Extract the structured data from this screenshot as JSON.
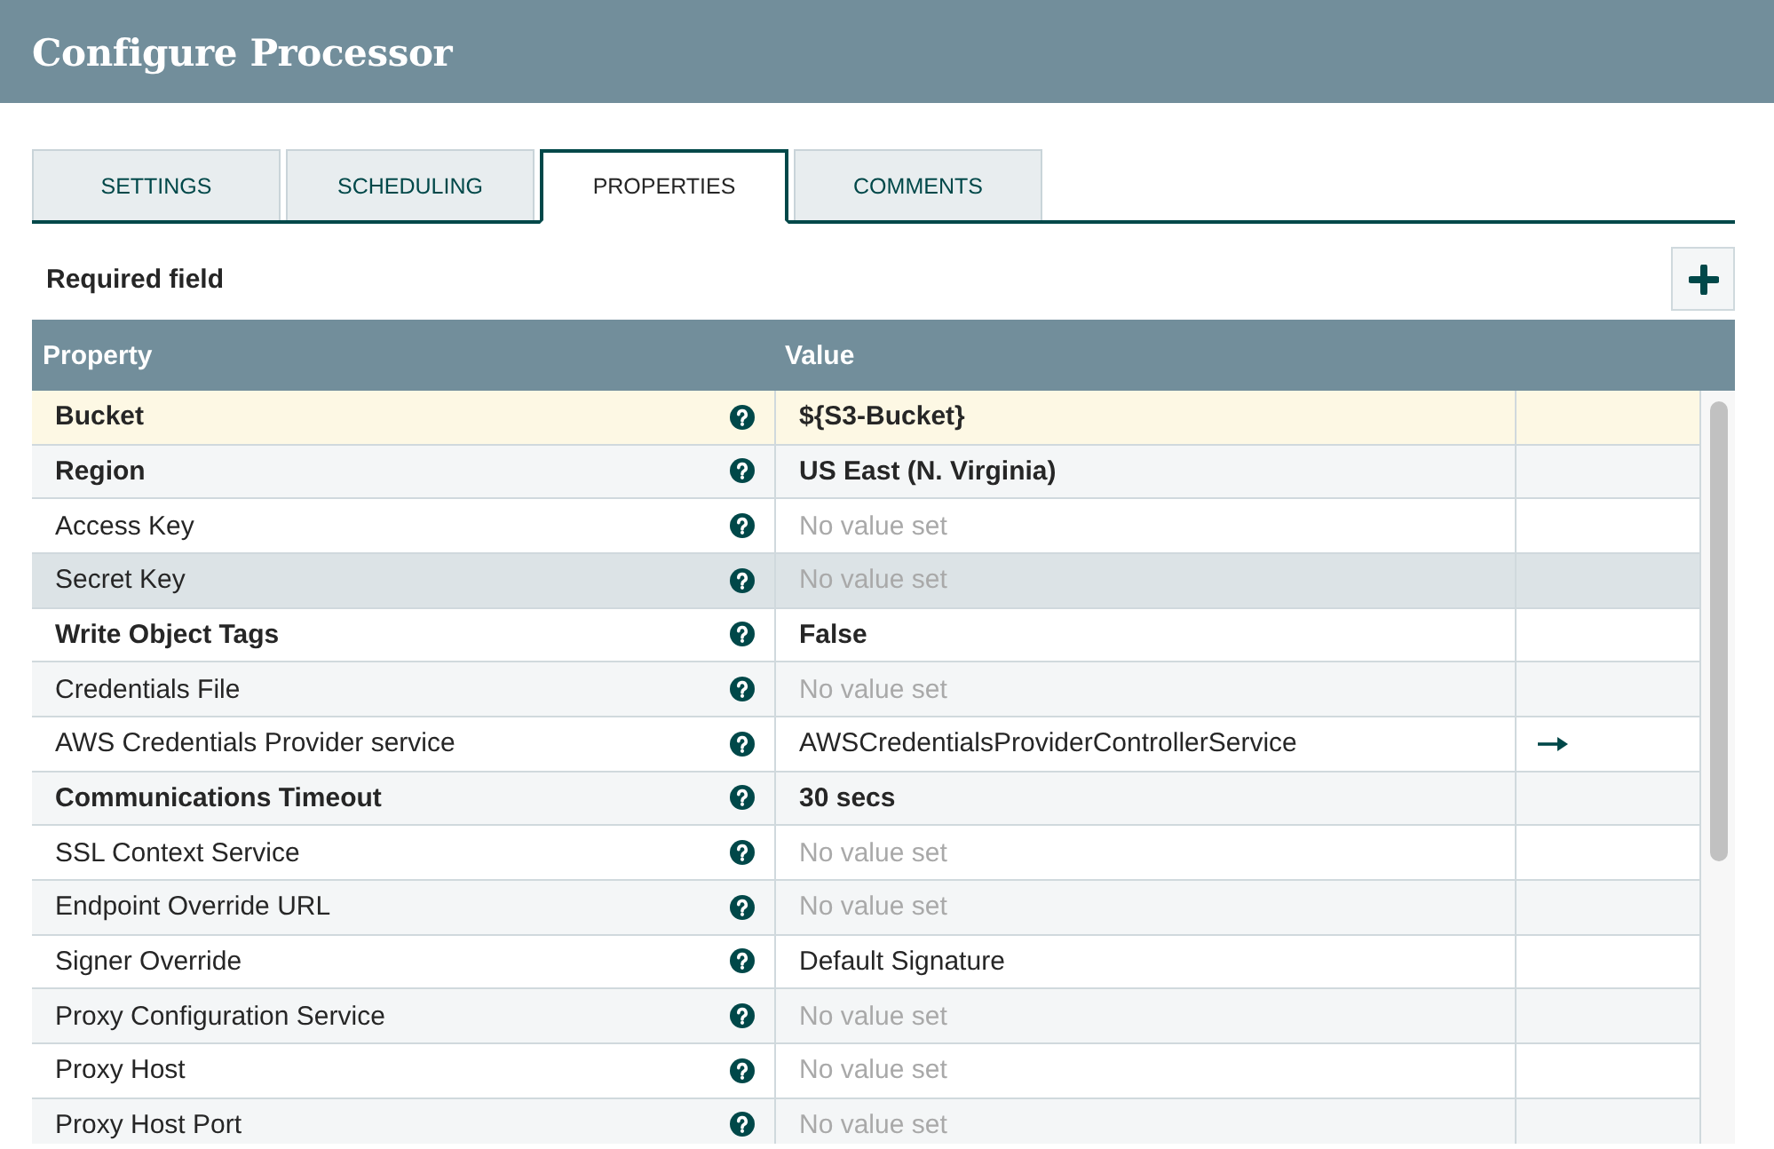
{
  "window": {
    "title": "Configure Processor"
  },
  "tabs": [
    {
      "label": "SETTINGS",
      "selected": false
    },
    {
      "label": "SCHEDULING",
      "selected": false
    },
    {
      "label": "PROPERTIES",
      "selected": true
    },
    {
      "label": "COMMENTS",
      "selected": false
    }
  ],
  "toolbar": {
    "label": "Required field"
  },
  "table": {
    "columns": [
      "Property",
      "Value"
    ],
    "rows": [
      {
        "property": "Bucket",
        "value": "${S3-Bucket}",
        "required": true,
        "value_set": true,
        "selected": true,
        "hovered": false,
        "service_link": false
      },
      {
        "property": "Region",
        "value": "US East (N. Virginia)",
        "required": true,
        "value_set": true,
        "selected": false,
        "hovered": false,
        "service_link": false
      },
      {
        "property": "Access Key",
        "value": "No value set",
        "required": false,
        "value_set": false,
        "selected": false,
        "hovered": false,
        "service_link": false
      },
      {
        "property": "Secret Key",
        "value": "No value set",
        "required": false,
        "value_set": false,
        "selected": false,
        "hovered": true,
        "service_link": false
      },
      {
        "property": "Write Object Tags",
        "value": "False",
        "required": true,
        "value_set": true,
        "selected": false,
        "hovered": false,
        "service_link": false
      },
      {
        "property": "Credentials File",
        "value": "No value set",
        "required": false,
        "value_set": false,
        "selected": false,
        "hovered": false,
        "service_link": false
      },
      {
        "property": "AWS Credentials Provider service",
        "value": "AWSCredentialsProviderControllerService",
        "required": false,
        "value_set": true,
        "selected": false,
        "hovered": false,
        "service_link": true
      },
      {
        "property": "Communications Timeout",
        "value": "30 secs",
        "required": true,
        "value_set": true,
        "selected": false,
        "hovered": false,
        "service_link": false
      },
      {
        "property": "SSL Context Service",
        "value": "No value set",
        "required": false,
        "value_set": false,
        "selected": false,
        "hovered": false,
        "service_link": false
      },
      {
        "property": "Endpoint Override URL",
        "value": "No value set",
        "required": false,
        "value_set": false,
        "selected": false,
        "hovered": false,
        "service_link": false
      },
      {
        "property": "Signer Override",
        "value": "Default Signature",
        "required": false,
        "value_set": true,
        "selected": false,
        "hovered": false,
        "service_link": false
      },
      {
        "property": "Proxy Configuration Service",
        "value": "No value set",
        "required": false,
        "value_set": false,
        "selected": false,
        "hovered": false,
        "service_link": false
      },
      {
        "property": "Proxy Host",
        "value": "No value set",
        "required": false,
        "value_set": false,
        "selected": false,
        "hovered": false,
        "service_link": false
      },
      {
        "property": "Proxy Host Port",
        "value": "No value set",
        "required": false,
        "value_set": false,
        "selected": false,
        "hovered": false,
        "service_link": false
      }
    ]
  }
}
